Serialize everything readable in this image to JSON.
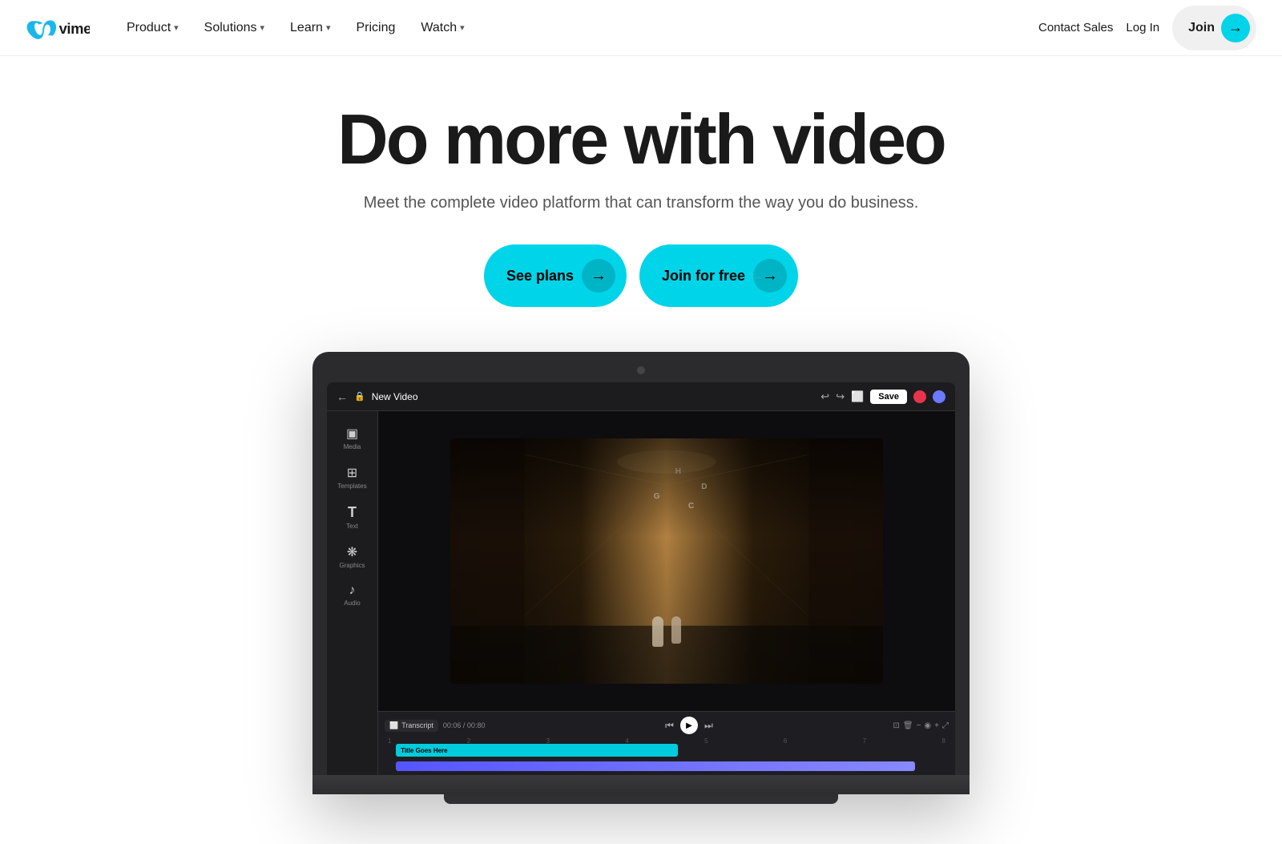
{
  "brand": {
    "name": "Vimeo"
  },
  "navbar": {
    "nav_items": [
      {
        "label": "Product",
        "has_dropdown": true
      },
      {
        "label": "Solutions",
        "has_dropdown": true
      },
      {
        "label": "Learn",
        "has_dropdown": true
      },
      {
        "label": "Pricing",
        "has_dropdown": false
      },
      {
        "label": "Watch",
        "has_dropdown": true
      }
    ],
    "contact_sales": "Contact Sales",
    "login": "Log In",
    "join": "Join",
    "join_arrow": "→"
  },
  "hero": {
    "title": "Do more with video",
    "subtitle": "Meet the complete video platform that can transform the way you do business.",
    "btn_see_plans": "See plans",
    "btn_join_free": "Join for free",
    "arrow": "→"
  },
  "editor": {
    "title": "New Video",
    "save_btn": "Save",
    "tools": [
      {
        "icon": "▣",
        "label": "Media"
      },
      {
        "icon": "⊞",
        "label": "Templates"
      },
      {
        "icon": "T",
        "label": "Text"
      },
      {
        "icon": "⊕",
        "label": "Graphics"
      },
      {
        "icon": "♪",
        "label": "Audio"
      }
    ],
    "timeline": {
      "transcript": "Transcript",
      "time": "00:06 / 00:80",
      "clip_label": "Title Goes Here",
      "rulers": [
        "1",
        "2",
        "3",
        "4",
        "5",
        "6",
        "7",
        "8"
      ]
    },
    "corridor_labels": [
      "H",
      "G",
      "D",
      "C"
    ]
  },
  "colors": {
    "accent_cyan": "#00d4e8",
    "nav_bg": "#ffffff",
    "body_bg": "#ffffff",
    "editor_bg": "#1c1c1f",
    "editor_dark": "#111113"
  }
}
